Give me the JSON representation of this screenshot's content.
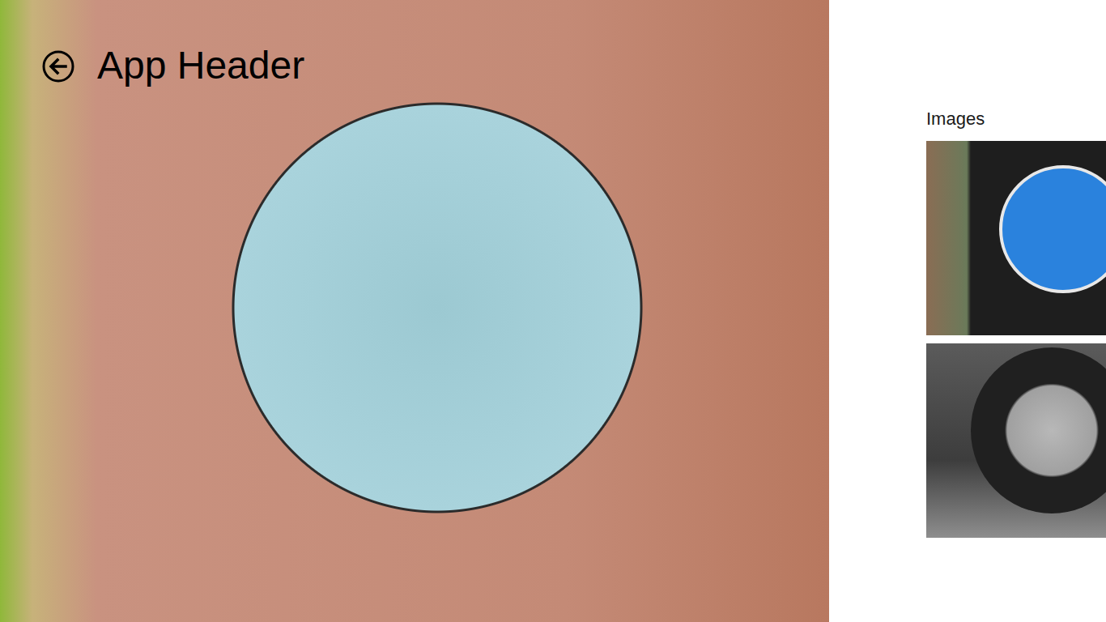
{
  "header": {
    "title": "App Header"
  },
  "section": {
    "title": "Images"
  }
}
